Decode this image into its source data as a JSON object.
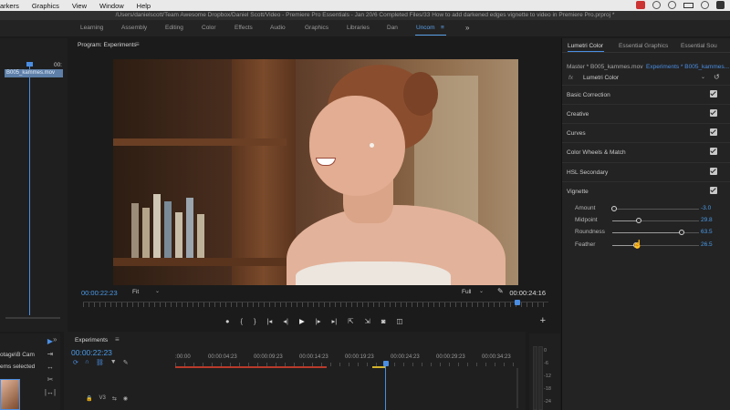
{
  "menubar": {
    "items": [
      "arkers",
      "Graphics",
      "View",
      "Window",
      "Help"
    ]
  },
  "titlebar": {
    "path": "/Users/danielscott/Team Awesome Dropbox/Daniel Scott/Video - Premiere Pro Essentials - Jan 20/6 Completed Files/33 How to add darkened edges vignette to video in Premiere Pro.prproj *"
  },
  "workspaces": {
    "items": [
      "Learning",
      "Assembly",
      "Editing",
      "Color",
      "Effects",
      "Audio",
      "Graphics",
      "Libraries",
      "Dan",
      "Uncom"
    ],
    "active": "Uncom",
    "more": "»"
  },
  "source_panel": {
    "time": "00:",
    "clip_name": "B005_kammes.mov"
  },
  "program": {
    "tab_label": "Program: Experiments",
    "timecode": "00:00:22:23",
    "duration": "00:00:24:16",
    "fit": "Fit",
    "quality": "Full"
  },
  "lumetri": {
    "tabs": [
      "Lumetri Color",
      "Essential Graphics",
      "Essential Sou"
    ],
    "master": "Master * B005_kammes.mov",
    "sequence": "Experiments * B005_kammes...",
    "fx_name": "Lumetri Color",
    "sections": [
      "Basic Correction",
      "Creative",
      "Curves",
      "Color Wheels & Match",
      "HSL Secondary",
      "Vignette"
    ],
    "vignette": [
      {
        "label": "Amount",
        "value": "-3.0",
        "fraction": 0.02
      },
      {
        "label": "Midpoint",
        "value": "29.8",
        "fraction": 0.3
      },
      {
        "label": "Roundness",
        "value": "63.5",
        "fraction": 0.8
      },
      {
        "label": "Feather",
        "value": "26.5",
        "fraction": 0.27
      }
    ]
  },
  "project": {
    "line1": "otage\\B Cam",
    "line2": "ems selected"
  },
  "timeline": {
    "tab_label": "Experiments",
    "timecode": "00:00:22:23",
    "ruler": [
      ":00:00",
      "00:00:04:23",
      "00:00:09:23",
      "00:00:14:23",
      "00:00:19:23",
      "00:00:24:23",
      "00:00:29:23",
      "00:00:34:23"
    ],
    "track_label": "V3"
  },
  "meters": {
    "scale": [
      "0",
      "-6",
      "-12",
      "-18",
      "-24"
    ]
  }
}
